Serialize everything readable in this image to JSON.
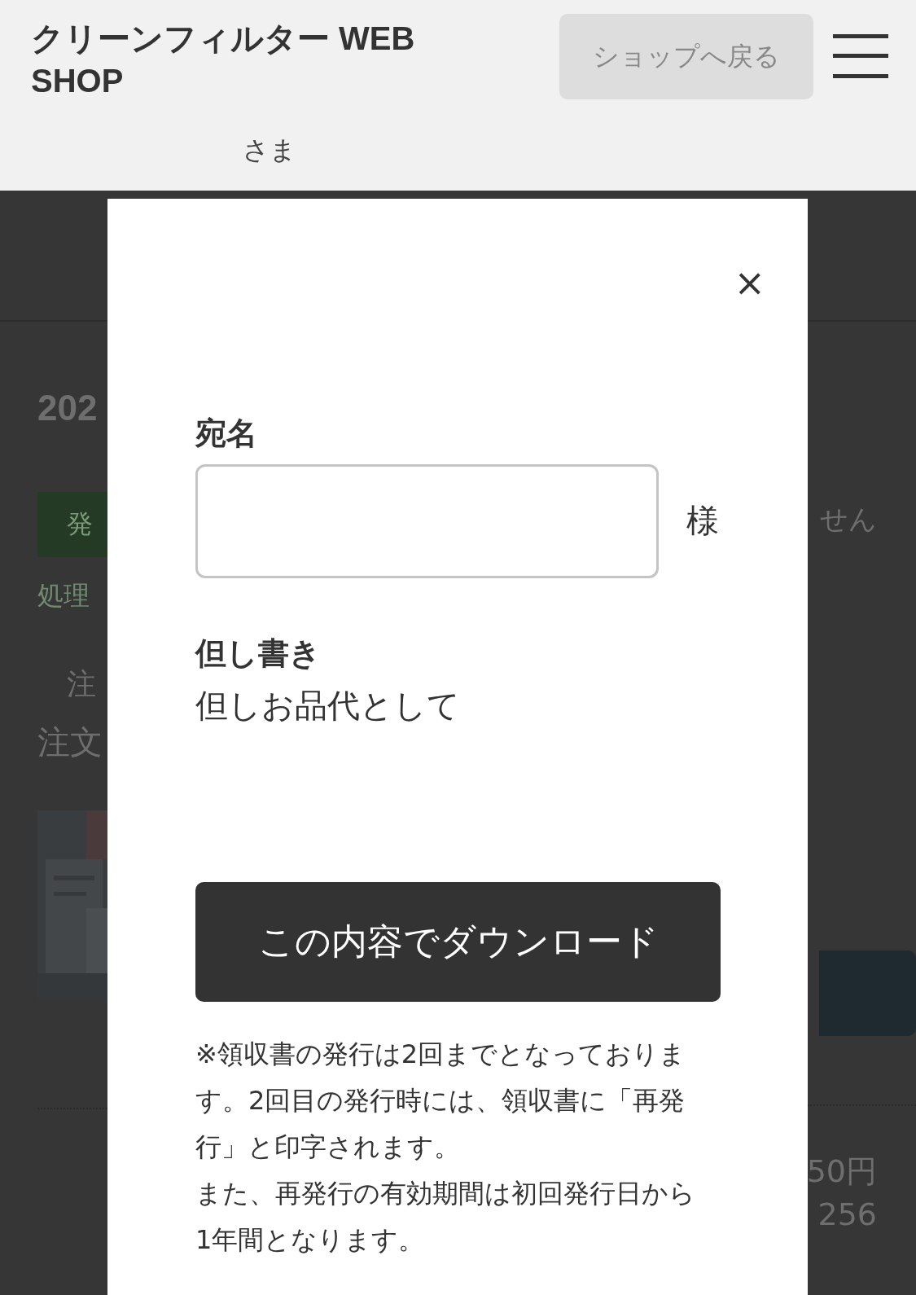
{
  "header": {
    "title": "クリーンフィルター WEB SHOP",
    "back_button": "ショップへ戻る",
    "greeting": "さま"
  },
  "background_left": {
    "year": "202",
    "status_badge": "発",
    "processed_label": "処理",
    "order_label": "注",
    "order_number_label": "注文"
  },
  "background_right": {
    "notice": "せん",
    "amount": "50円",
    "number": "256"
  },
  "modal": {
    "close": "×",
    "recipient_label": "宛名",
    "recipient_suffix": "様",
    "proviso_label": "但し書き",
    "proviso_value": "但しお品代として",
    "download_button": "この内容でダウンロード",
    "notes": [
      "※領収書の発行は2回までとなっております。2回目の発行時には、領収書に「再発行」と印字されます。",
      "また、再発行の有効期間は初回発行日から1年間となります。"
    ]
  }
}
